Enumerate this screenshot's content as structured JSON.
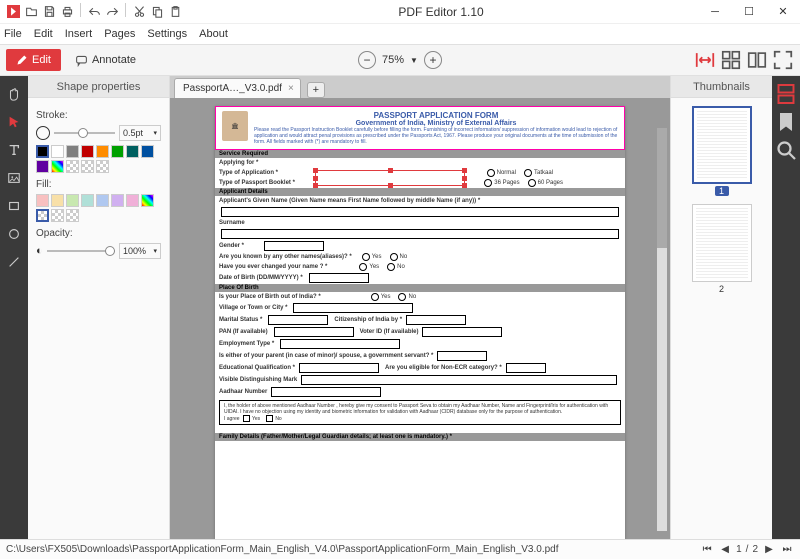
{
  "app": {
    "title": "PDF Editor 1.10"
  },
  "menu": [
    "File",
    "Edit",
    "Insert",
    "Pages",
    "Settings",
    "About"
  ],
  "toolbar": {
    "edit": "Edit",
    "annotate": "Annotate",
    "zoom": "75%"
  },
  "tab": {
    "name": "PassportA…_V3.0.pdf"
  },
  "panels": {
    "shape": "Shape properties",
    "thumbs": "Thumbnails"
  },
  "props": {
    "stroke_label": "Stroke:",
    "stroke_value": "0.5pt",
    "fill_label": "Fill:",
    "opacity_label": "Opacity:",
    "opacity_value": "100%",
    "stroke_colors": [
      "#000000",
      "#ffffff",
      "#7f7f7f",
      "#c00000",
      "#ff8c00",
      "#00a000",
      "#006060",
      "#0050a0",
      "#6000a0"
    ],
    "fill_colors": [
      "#f8c0c0",
      "#f8e0a8",
      "#c8e8b0",
      "#b0e0d8",
      "#b0c8f0",
      "#d0b0f0",
      "#f0b0d8"
    ]
  },
  "form": {
    "title": "PASSPORT APPLICATION FORM",
    "subtitle": "Government of India, Ministry of External Affairs",
    "instructions": "Please read the Passport Instruction Booklet carefully before filling the form. Furnishing of incorrect information/ suppression of information would lead to rejection of application and would attract penal provisions as prescribed under the Passports Act, 1967. Please produce your original documents at the time of submission of the form. All fields marked with (*) are mandatory to fill.",
    "sec_service": "Service Required",
    "applying_for": "Applying for *",
    "type_app": "Type of Application *",
    "type_app_opts": [
      "Normal",
      "Tatkaal"
    ],
    "type_booklet": "Type of Passport Booklet *",
    "type_booklet_opts": [
      "36 Pages",
      "60 Pages"
    ],
    "sec_applicant": "Applicant Details",
    "given_name": "Applicant's Given Name (Given Name means First Name followed by middle Name (if any)) *",
    "surname": "Surname",
    "gender": "Gender *",
    "aliases": "Are you known by any other names(aliases)? *",
    "changed_name": "Have you ever changed your name ? *",
    "yes": "Yes",
    "no": "No",
    "dob": "Date of Birth (DD/MM/YYYY) *",
    "sec_pob": "Place Of Birth",
    "pob_out": "Is your Place of Birth out of India? *",
    "village": "Village or Town or City *",
    "marital": "Marital Status *",
    "citizenship": "Citizenship of India by *",
    "pan": "PAN (If available)",
    "voter": "Voter ID (If available)",
    "employment": "Employment Type *",
    "parent_govt": "Is either of your parent (in case of minor)/ spouse, a government servant? *",
    "edu": "Educational Qualification *",
    "non_ecr": "Are you eligible for Non-ECR category? *",
    "dist_mark": "Visible Distinguishing Mark",
    "aadhaar": "Aadhaar Number",
    "consent": "I, the holder of above mentioned Aadhaar Number , hereby give my consent to Passport Seva to obtain my Aadhaar Number, Name and Fingerprint/Iris for authentication with UIDAI. I have no objection using my identity and biometric information for validation with Aadhaar (CIDR) database only for the purpose of authentication.",
    "agree": "I agree",
    "sec_family": "Family Details (Father/Mother/Legal Guardian details; at least one is mandatory.) *"
  },
  "thumbs": {
    "p1": "1",
    "p2": "2"
  },
  "status": {
    "path": "C:\\Users\\FX505\\Downloads\\PassportApplicationForm_Main_English_V4.0\\PassportApplicationForm_Main_English_V3.0.pdf",
    "page": "1",
    "sep": "/",
    "total": "2"
  }
}
